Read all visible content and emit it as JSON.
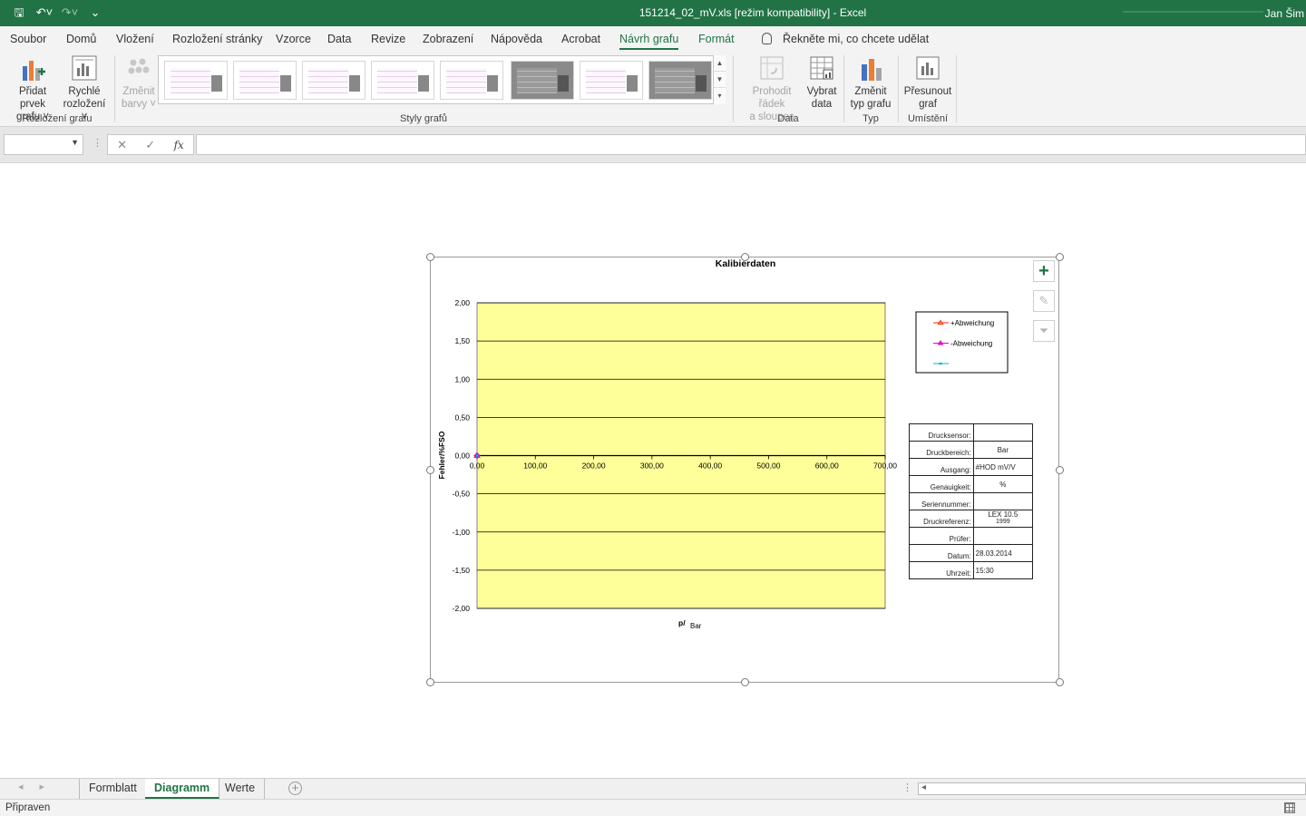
{
  "window": {
    "title": "151214_02_mV.xls  [režim kompatibility]  -  Excel",
    "user": "Jan Šim"
  },
  "ribbon_tabs": [
    "Soubor",
    "Domů",
    "Vložení",
    "Rozložení stránky",
    "Vzorce",
    "Data",
    "Revize",
    "Zobrazení",
    "Nápověda",
    "Acrobat",
    "Návrh grafu",
    "Formát"
  ],
  "active_tab": "Návrh grafu",
  "tell_me": "Řekněte mi, co chcete udělat",
  "ribbon": {
    "add_element": [
      "Přidat prvek",
      "grafu ˅"
    ],
    "quick_layout": [
      "Rychlé",
      "rozložení ˅"
    ],
    "change_colors": [
      "Změnit",
      "barvy ˅"
    ],
    "group_layouts": "Rozložení grafu",
    "group_styles": "Styly grafů",
    "switch_row_col": [
      "Prohodit řádek",
      "a sloupec"
    ],
    "select_data": [
      "Vybrat",
      "data"
    ],
    "group_data": "Data",
    "change_type": [
      "Změnit",
      "typ grafu"
    ],
    "group_type": "Typ",
    "move_chart": [
      "Přesunout",
      "graf"
    ],
    "group_location": "Umístění"
  },
  "formula": {
    "fx": "fx"
  },
  "chart_data": {
    "type": "line",
    "title": "Kalibierdaten",
    "ylabel": "Fehler/%FSO",
    "xlabel_main": "p/",
    "xlabel_sub": "Bar",
    "ylim": [
      -2.0,
      2.0
    ],
    "xlim": [
      0,
      700
    ],
    "y_ticks": [
      "2,00",
      "1,50",
      "1,00",
      "0,50",
      "0,00",
      "-0,50",
      "-1,00",
      "-1,50",
      "-2,00"
    ],
    "x_ticks": [
      "0,00",
      "100,00",
      "200,00",
      "300,00",
      "400,00",
      "500,00",
      "600,00",
      "700,00"
    ],
    "plot_bg": "#ffff99",
    "grid": true,
    "series": [
      {
        "name": "+Abweichung",
        "color": "#ff2a00",
        "x": [
          0
        ],
        "y": [
          0
        ]
      },
      {
        "name": "-Abweichung",
        "color": "#ee00cc",
        "x": [
          0
        ],
        "y": [
          0
        ]
      },
      {
        "name": "",
        "color": "#00b8d4",
        "x": [
          0
        ],
        "y": [
          0
        ]
      }
    ],
    "legend_placement": "right"
  },
  "info_table": {
    "rows": [
      {
        "k": "Drucksensor:",
        "v": ""
      },
      {
        "k": "Druckbereich:",
        "v": "Bar"
      },
      {
        "k": "Ausgang:",
        "v": "#HOD     mV/V"
      },
      {
        "k": "Genauigkeit:",
        "v": "%"
      },
      {
        "k": "Seriennummer:",
        "v": ""
      },
      {
        "k": "Druckreferenz:",
        "v": "LEX    10.5",
        "v2": "1999"
      },
      {
        "k": "Prüfer:",
        "v": ""
      },
      {
        "k": "Datum:",
        "v": "28.03.2014"
      },
      {
        "k": "Uhrzeit:",
        "v": "15:30"
      }
    ]
  },
  "sheet_tabs": [
    "Formblatt",
    "Diagramm",
    "Werte"
  ],
  "active_sheet": "Diagramm",
  "status": {
    "ready": "Připraven"
  }
}
